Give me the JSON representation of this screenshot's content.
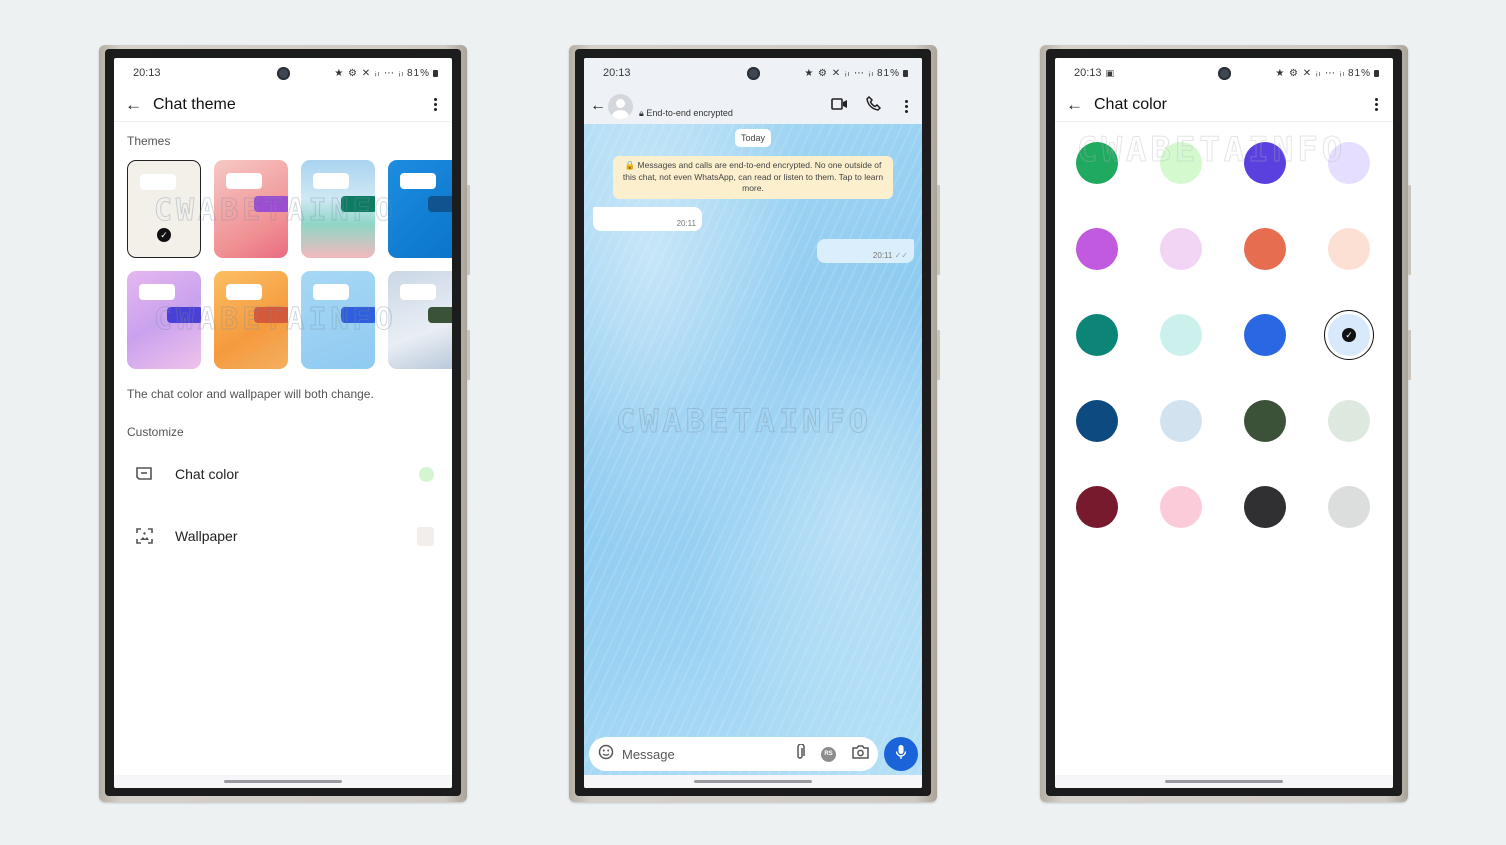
{
  "status": {
    "time": "20:13",
    "icons": "★ ⚙ ✕ ᵢₗ ⋯ ᵢₗ",
    "battery": "81%"
  },
  "screen1": {
    "title": "Chat theme",
    "themes_label": "Themes",
    "themes": [
      {
        "name": "default",
        "bg": "#f3f0ea",
        "bubble": "transparent",
        "selected": true,
        "check": "✓"
      },
      {
        "name": "pink-flower",
        "bg": "linear-gradient(150deg,#f6c9c4,#f08f93 70%,#e96b7f)",
        "bubble": "#9b4fd0"
      },
      {
        "name": "beach",
        "bg": "linear-gradient(180deg,#a9d4ef 0%,#cfe8f5 40%,#8fd6c7 65%,#f3b9bd 100%)",
        "bubble": "#0f7b63"
      },
      {
        "name": "blue-lines",
        "bg": "linear-gradient(135deg,#1d8de0,#0a73c9)",
        "bubble": "#11538f"
      },
      {
        "name": "lilac",
        "bg": "linear-gradient(150deg,#e6b7ef,#c9a2ef 50%,#f0c2ea)",
        "bubble": "#4a3fd6"
      },
      {
        "name": "orange",
        "bg": "linear-gradient(150deg,#fbbf63,#f59a3e 60%,#f4b061)",
        "bubble": "#d45a3c"
      },
      {
        "name": "sky-feather",
        "bg": "linear-gradient(160deg,#a7d8f5,#8fcaf1)",
        "bubble": "#2f5fdc"
      },
      {
        "name": "clouds",
        "bg": "linear-gradient(160deg,#cad7e6,#e9eef4 60%,#b6c6d8)",
        "bubble": "#3a5237"
      }
    ],
    "note": "The chat color and wallpaper will both change.",
    "customize_label": "Customize",
    "rows": [
      {
        "label": "Chat color",
        "value_color": "#d3f5cf"
      },
      {
        "label": "Wallpaper",
        "value_color": "#f3eeea"
      }
    ],
    "watermark": "CWABETAINFO"
  },
  "screen2": {
    "subtitle": "End-to-end encrypted",
    "date_chip": "Today",
    "e2e_notice": "🔒 Messages and calls are end-to-end encrypted. No one outside of this chat, not even WhatsApp, can read or listen to them. Tap to learn more.",
    "messages": [
      {
        "direction": "in",
        "time": "20:11"
      },
      {
        "direction": "out",
        "time": "20:11",
        "ticks": "✓✓"
      }
    ],
    "composer_placeholder": "Message",
    "avatar_initials": "RS",
    "watermark": "CWABETAINFO"
  },
  "screen3": {
    "title": "Chat color",
    "colors": [
      {
        "hex": "#1faa5f"
      },
      {
        "hex": "#d4f9cf"
      },
      {
        "hex": "#5a40de"
      },
      {
        "hex": "#e5deff"
      },
      {
        "hex": "#c25ae0"
      },
      {
        "hex": "#f2d4f5"
      },
      {
        "hex": "#e76d50"
      },
      {
        "hex": "#fde0d4"
      },
      {
        "hex": "#0c8576"
      },
      {
        "hex": "#ccf1ec"
      },
      {
        "hex": "#2a67e3"
      },
      {
        "hex": "#d7e9fb",
        "selected": true
      },
      {
        "hex": "#0c4a7f"
      },
      {
        "hex": "#d2e3ef"
      },
      {
        "hex": "#3b5238"
      },
      {
        "hex": "#dde8df"
      },
      {
        "hex": "#771a2d"
      },
      {
        "hex": "#fccbd9"
      },
      {
        "hex": "#303033"
      },
      {
        "hex": "#dcdddd"
      }
    ],
    "check": "✓",
    "watermark": "CWABETAINFO"
  }
}
